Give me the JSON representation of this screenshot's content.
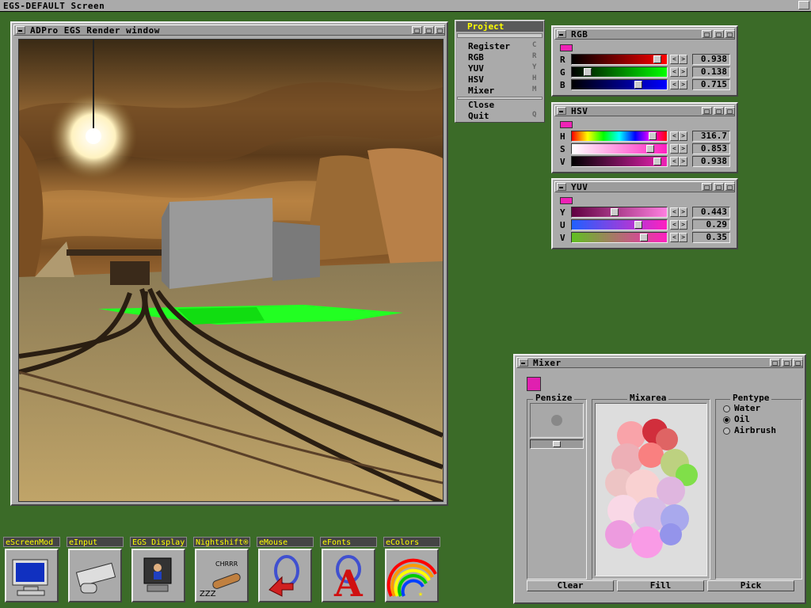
{
  "screen": {
    "title": "EGS-DEFAULT Screen"
  },
  "render_window": {
    "title": "ADPro EGS Render window"
  },
  "menu": {
    "header": "Project",
    "items": [
      {
        "label": "Register",
        "key": "C"
      },
      {
        "label": "RGB",
        "key": "R"
      },
      {
        "label": "YUV",
        "key": "Y"
      },
      {
        "label": "HSV",
        "key": "H"
      },
      {
        "label": "Mixer",
        "key": "M"
      }
    ],
    "items2": [
      {
        "label": "Close",
        "key": ""
      },
      {
        "label": "Quit",
        "key": "Q"
      }
    ]
  },
  "rgb_panel": {
    "title": "RGB",
    "swatch_color": "#ef23b6",
    "rows": [
      {
        "label": "R",
        "value": "0.938",
        "level": 0.938
      },
      {
        "label": "G",
        "value": "0.138",
        "level": 0.138
      },
      {
        "label": "B",
        "value": "0.715",
        "level": 0.715
      }
    ]
  },
  "hsv_panel": {
    "title": "HSV",
    "swatch_color": "#ef23b6",
    "rows": [
      {
        "label": "H",
        "value": "316.7",
        "level": 0.88
      },
      {
        "label": "S",
        "value": "0.853",
        "level": 0.853
      },
      {
        "label": "V",
        "value": "0.938",
        "level": 0.938
      }
    ]
  },
  "yuv_panel": {
    "title": "YUV",
    "swatch_color": "#ef23b6",
    "rows": [
      {
        "label": "Y",
        "value": "0.443",
        "level": 0.443
      },
      {
        "label": "U",
        "value": "0.29",
        "level": 0.72
      },
      {
        "label": "V",
        "value": "0.35",
        "level": 0.78
      }
    ]
  },
  "mixer": {
    "title": "Mixer",
    "swatch_color": "#e020b0",
    "pensize_label": "Pensize",
    "pensize_level": 0.5,
    "mixarea_label": "Mixarea",
    "pentype_label": "Pentype",
    "pentypes": [
      {
        "label": "Water",
        "selected": false
      },
      {
        "label": "Oil",
        "selected": true
      },
      {
        "label": "Airbrush",
        "selected": false
      }
    ],
    "buttons": {
      "clear": "Clear",
      "fill": "Fill",
      "pick": "Pick"
    }
  },
  "tools": [
    {
      "label": "eScreenMod",
      "icon": "monitor-icon"
    },
    {
      "label": "eInput",
      "icon": "keyboard-icon"
    },
    {
      "label": "EGS Display",
      "icon": "display-icon"
    },
    {
      "label": "Nightshift®",
      "icon": "sleep-icon"
    },
    {
      "label": "eMouse",
      "icon": "mouse-icon"
    },
    {
      "label": "eFonts",
      "icon": "font-icon"
    },
    {
      "label": "eColors",
      "icon": "rainbow-icon"
    }
  ],
  "colors": {
    "desktop": "#3b6b28",
    "accent_yellow": "#ffff00",
    "window_grey": "#aaaaaa"
  }
}
